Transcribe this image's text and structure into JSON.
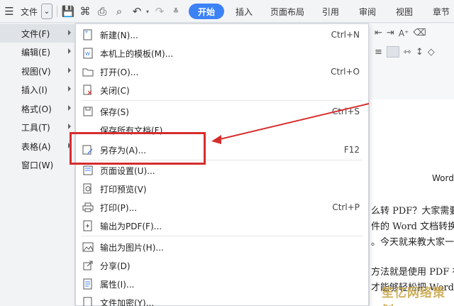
{
  "toolbar": {
    "file_label": "文件",
    "tabs": [
      {
        "label": "开始",
        "active": true
      },
      {
        "label": "插入",
        "active": false
      },
      {
        "label": "页面布局",
        "active": false
      },
      {
        "label": "引用",
        "active": false
      },
      {
        "label": "审阅",
        "active": false
      },
      {
        "label": "视图",
        "active": false
      },
      {
        "label": "章节",
        "active": false
      }
    ]
  },
  "left_menu": {
    "items": [
      {
        "label": "文件(F)",
        "active": true
      },
      {
        "label": "编辑(E)",
        "active": false
      },
      {
        "label": "视图(V)",
        "active": false
      },
      {
        "label": "插入(I)",
        "active": false
      },
      {
        "label": "格式(O)",
        "active": false
      },
      {
        "label": "工具(T)",
        "active": false
      },
      {
        "label": "表格(A)",
        "active": false
      },
      {
        "label": "窗口(W)",
        "active": false
      }
    ]
  },
  "file_menu": {
    "items": [
      {
        "label": "新建(N)...",
        "shortcut": "Ctrl+N",
        "icon": "new-doc-icon"
      },
      {
        "label": "本机上的模板(M)...",
        "shortcut": "",
        "icon": "template-icon"
      },
      {
        "label": "打开(O)...",
        "shortcut": "Ctrl+O",
        "icon": "folder-icon"
      },
      {
        "label": "关闭(C)",
        "shortcut": "",
        "icon": "close-doc-icon"
      },
      {
        "label": "保存(S)",
        "shortcut": "Ctrl+S",
        "icon": "save-icon"
      },
      {
        "label": "保存所有文档(F)",
        "shortcut": "",
        "icon": ""
      },
      {
        "label": "另存为(A)...",
        "shortcut": "F12",
        "icon": "save-as-icon"
      },
      {
        "label": "页面设置(U)...",
        "shortcut": "",
        "icon": "page-setup-icon"
      },
      {
        "label": "打印预览(V)",
        "shortcut": "",
        "icon": "print-preview-icon"
      },
      {
        "label": "打印(P)...",
        "shortcut": "Ctrl+P",
        "icon": "print-icon"
      },
      {
        "label": "输出为PDF(F)...",
        "shortcut": "",
        "icon": "pdf-icon"
      },
      {
        "label": "输出为图片(H)...",
        "shortcut": "",
        "icon": "image-icon"
      },
      {
        "label": "分享(D)",
        "shortcut": "",
        "icon": "share-icon"
      },
      {
        "label": "属性(I)...",
        "shortcut": "",
        "icon": "properties-icon"
      },
      {
        "label": "文件加密(Y)...",
        "shortcut": "",
        "icon": "encrypt-icon"
      }
    ]
  },
  "document": {
    "lines": [
      "Word",
      "么转 PDF？大家需要",
      "件的 Word 文档转换",
      "。今天就来教大家一",
      "方法就是使用 PDF 在",
      "才能够轻松把 Word"
    ]
  },
  "watermark": "笙亿网络策划",
  "colors": {
    "accent": "#3b82f6",
    "highlight": "#d62d2d"
  }
}
